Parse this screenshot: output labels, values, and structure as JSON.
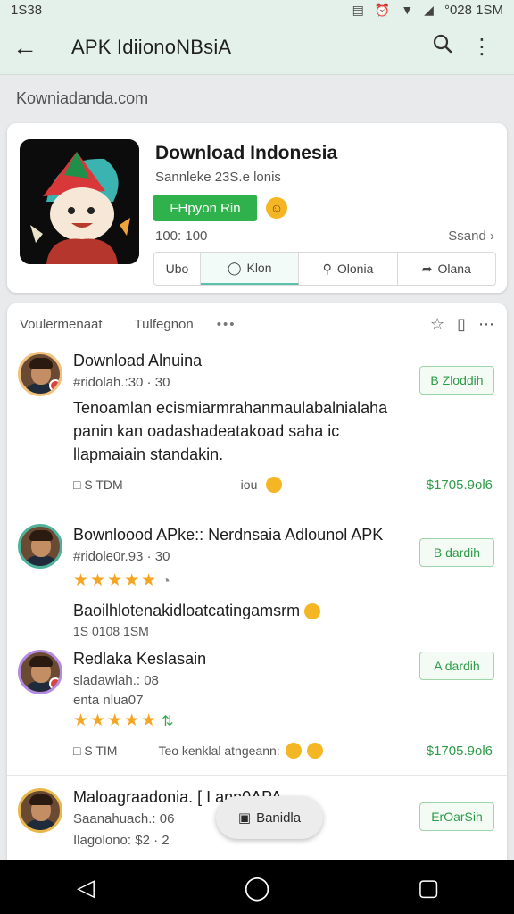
{
  "status_bar": {
    "time": "1S38",
    "right_text": "°028 1SM"
  },
  "app_bar": {
    "title": "APK IdiionoNBsiA"
  },
  "url": "Kowniadanda.com",
  "app_card": {
    "name": "Download Indonesia",
    "subtitle": "Sannleke 23S.e lonis",
    "install_label": "FHpyon Rin",
    "stat": "100: 100",
    "see_all": "Ssand",
    "actions": [
      "Ubo",
      "Klon",
      "Olonia",
      "Olana"
    ]
  },
  "feed": {
    "tab1": "Voulermenaat",
    "tab2": "Tulfegnon",
    "posts": [
      {
        "title": "Download Alnuina",
        "meta": "#ridolah.:30 · 30",
        "button": "B Zloddih",
        "body": "Tenoamlan ecismiarmrahanmaulabalnialaha panin kan oadashadeatakoad saha ic llapmaiain standakin.",
        "foot_left": "S TDM",
        "foot_mid": "iou",
        "price": "$1705.9ol6"
      },
      {
        "title": "Bownloood APke:: Nerdnsaia Adlounol APK",
        "meta": "#ridole0r.93 · 30",
        "button": "B dardih",
        "stars": "★★★★★",
        "body": "Baoilhlotenakidloatcatingamsrm",
        "foot_left": "1S 0108 1SM"
      },
      {
        "title": "Redlaka Keslasain",
        "meta": "sladawlah.: 08",
        "meta2": "enta nlua07",
        "button": "A dardih",
        "stars": "★★★★★",
        "foot_left": "S TIM",
        "foot_mid": "Teo kenklal atngeann:",
        "price": "$1705.9ol6"
      },
      {
        "title": "Maloagraadonia. [ I                    ann0APA",
        "meta": "Saanahuach.: 06",
        "meta2": "Ilagolono: $2 · 2",
        "button": "ErOarSih"
      }
    ]
  },
  "toast": "Banidla",
  "colors": {
    "accent": "#2fb24c",
    "appbar": "#e4f1ea"
  }
}
